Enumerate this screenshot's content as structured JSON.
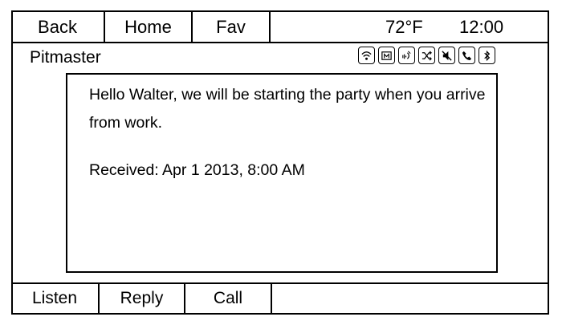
{
  "nav": {
    "back_label": "Back",
    "home_label": "Home",
    "fav_label": "Fav"
  },
  "status": {
    "temperature": "72°F",
    "time": "12:00"
  },
  "title": "Pitmaster",
  "status_icons": [
    "wifi-icon",
    "media-icon",
    "voice-icon",
    "shuffle-icon",
    "mute-icon",
    "phone-icon",
    "bluetooth-icon"
  ],
  "message": {
    "body": "Hello Walter, we will be starting the party when you arrive from work.",
    "received": "Received: Apr 1 2013, 8:00 AM"
  },
  "actions": {
    "listen_label": "Listen",
    "reply_label": "Reply",
    "call_label": "Call"
  }
}
